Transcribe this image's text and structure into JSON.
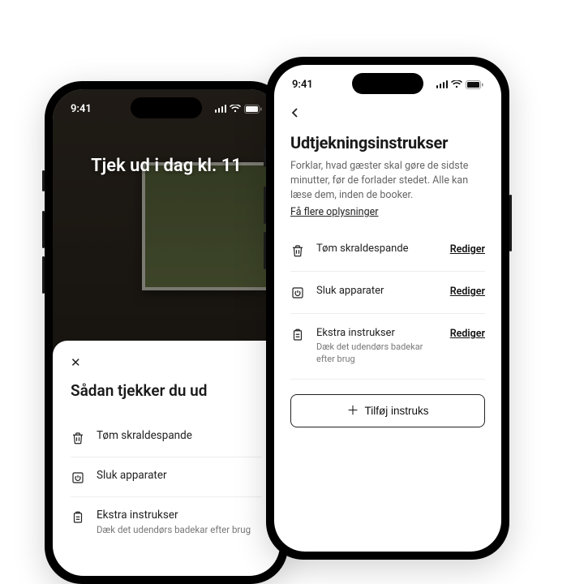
{
  "status": {
    "time": "9:41"
  },
  "back_phone": {
    "hero": "Tjek ud i dag kl. 11",
    "sheet_title": "Sådan tjekker du ud",
    "items": [
      {
        "label": "Tøm skraldespande",
        "sub": ""
      },
      {
        "label": "Sluk apparater",
        "sub": ""
      },
      {
        "label": "Ekstra instrukser",
        "sub": "Dæk det udendørs badekar efter brug"
      }
    ]
  },
  "front_phone": {
    "title": "Udtjekningsinstrukser",
    "description": "Forklar, hvad gæster skal gøre de sidste minutter, før de forlader stedet. Alle kan læse dem, inden de booker.",
    "learn_more": "Få flere oplysninger",
    "edit_label": "Rediger",
    "items": [
      {
        "label": "Tøm skraldespande",
        "sub": ""
      },
      {
        "label": "Sluk apparater",
        "sub": ""
      },
      {
        "label": "Ekstra instrukser",
        "sub": "Dæk det udendørs badekar efter brug"
      }
    ],
    "add_button": "Tilføj instruks"
  }
}
